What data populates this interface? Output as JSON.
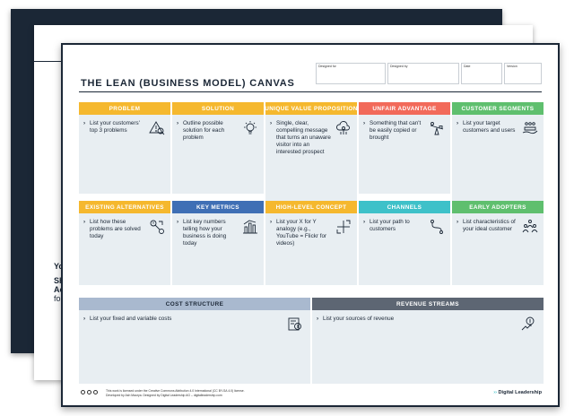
{
  "back_sheets": {
    "line1": "Yo",
    "line2": "Sh",
    "line3": "Ac",
    "line4": "fo"
  },
  "canvas": {
    "title": "THE LEAN (BUSINESS MODEL) CANVAS",
    "meta_fields": [
      "Designed for",
      "Designed by",
      "Date",
      "Version"
    ]
  },
  "blocks": {
    "problem": {
      "header": "PROBLEM",
      "text": "List your customers' top 3 problems",
      "color": "#f5b82e"
    },
    "solution": {
      "header": "SOLUTION",
      "text": "Outline possible solution for each problem",
      "color": "#f5b82e"
    },
    "uvp": {
      "header": "UNIQUE VALUE PROPOSITION",
      "text": "Single, clear, compelling message that turns an unaware visitor into an interested prospect",
      "color": "#f5b82e"
    },
    "unfair": {
      "header": "UNFAIR ADVANTAGE",
      "text": "Something that can't be easily copied or brought",
      "color": "#f26a5a"
    },
    "segments": {
      "header": "CUSTOMER SEGMENTS",
      "text": "List your target customers and users",
      "color": "#5fbf6e"
    },
    "alternatives": {
      "header": "EXISTING ALTERNATIVES",
      "text": "List how these problems are solved today",
      "color": "#f5b82e"
    },
    "metrics": {
      "header": "KEY METRICS",
      "text": "List key numbers telling how your business is doing today",
      "color": "#3f6fb5"
    },
    "concept": {
      "header": "HIGH-LEVEL CONCEPT",
      "text": "List your X for Y analogy (e.g., YouTube = Flickr for videos)",
      "color": "#f5b82e"
    },
    "channels": {
      "header": "CHANNELS",
      "text": "List your path to customers",
      "color": "#3ec1c9"
    },
    "adopters": {
      "header": "EARLY ADOPTERS",
      "text": "List characteristics of your ideal customer",
      "color": "#5fbf6e"
    },
    "cost": {
      "header": "COST STRUCTURE",
      "text": "List your fixed and variable costs",
      "color": "#a9b9cf"
    },
    "revenue": {
      "header": "REVENUE STREAMS",
      "text": "List your sources of revenue",
      "color": "#5d6673"
    }
  },
  "footer": {
    "license": "This work is licensed under the Creative Commons Attribution 4.0 International (CC BY-SA 4.0) license.",
    "credits": "Developed by Ash Maurya. Designed by Digital Leadership AG – digitalleadership.com",
    "brand": "Digital Leadership"
  },
  "icons": [
    "warning-search-icon",
    "lightbulb-icon",
    "target-cloud-icon",
    "balance-icon",
    "people-hand-icon",
    "alternatives-icon",
    "bar-chart-icon",
    "arrows-icon",
    "route-icon",
    "group-icon",
    "money-doc-icon",
    "revenue-icon"
  ]
}
